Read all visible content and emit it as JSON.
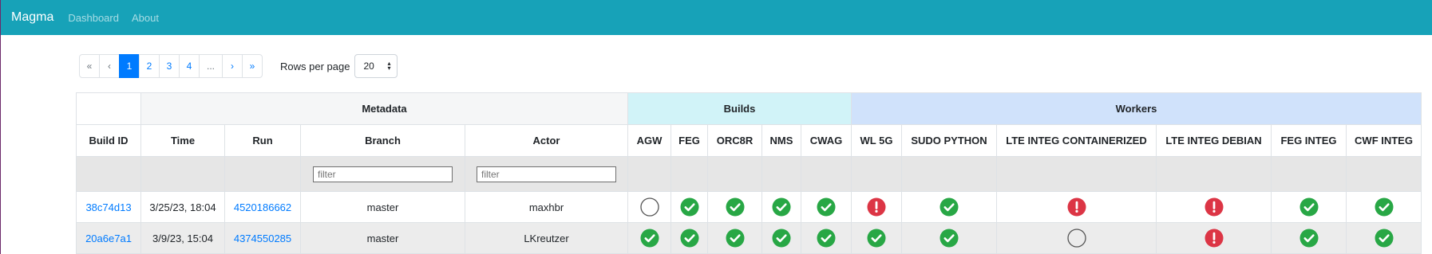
{
  "nav": {
    "brand": "Magma",
    "links": [
      "Dashboard",
      "About"
    ]
  },
  "pagination": {
    "items": [
      "«",
      "‹",
      "1",
      "2",
      "3",
      "4",
      "...",
      "›",
      "»"
    ],
    "active": "1"
  },
  "rows_per_page": {
    "label": "Rows per page",
    "value": "20"
  },
  "table": {
    "groups": {
      "metadata": "Metadata",
      "builds": "Builds",
      "workers": "Workers"
    },
    "columns": [
      "Build ID",
      "Time",
      "Run",
      "Branch",
      "Actor",
      "AGW",
      "FEG",
      "ORC8R",
      "NMS",
      "CWAG",
      "WL 5G",
      "SUDO PYTHON",
      "LTE INTEG CONTAINERIZED",
      "LTE INTEG DEBIAN",
      "FEG INTEG",
      "CWF INTEG"
    ],
    "filters": {
      "branch_placeholder": "filter",
      "actor_placeholder": "filter"
    },
    "rows": [
      {
        "build_id": "38c74d13",
        "time": "3/25/23, 18:04",
        "run": "4520186662",
        "branch": "master",
        "actor": "maxhbr",
        "statuses": [
          "none",
          "success",
          "success",
          "success",
          "success",
          "failure",
          "success",
          "failure",
          "failure",
          "success",
          "success"
        ]
      },
      {
        "build_id": "20a6e7a1",
        "time": "3/9/23, 15:04",
        "run": "4374550285",
        "branch": "master",
        "actor": "LKreutzer",
        "statuses": [
          "success",
          "success",
          "success",
          "success",
          "success",
          "success",
          "success",
          "none",
          "failure",
          "success",
          "success"
        ]
      }
    ]
  },
  "colors": {
    "navbar": "#17a2b8",
    "link": "#007bff",
    "success": "#28a745",
    "failure": "#dc3545",
    "builds_header": "#d1f3f8",
    "workers_header": "#d0e2fb"
  }
}
